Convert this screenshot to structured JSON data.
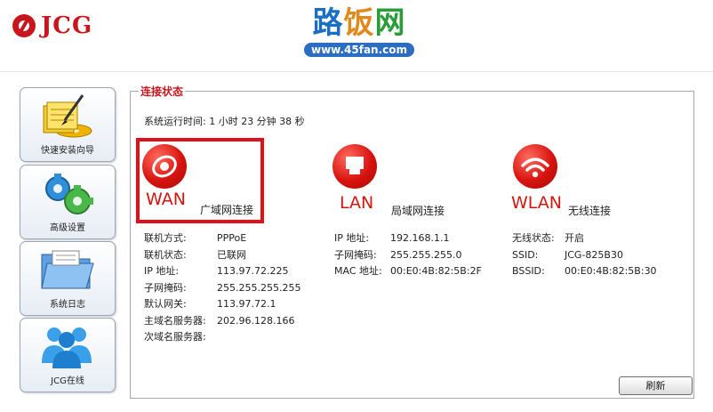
{
  "header": {
    "brand": "JCG",
    "site_name": [
      "路",
      "饭",
      "网"
    ],
    "site_url": "www.45fan.com"
  },
  "sidebar": {
    "items": [
      {
        "label": "快速安装向导",
        "icon": "setup-wizard-icon"
      },
      {
        "label": "高级设置",
        "icon": "gears-icon"
      },
      {
        "label": "系统日志",
        "icon": "folder-icon"
      },
      {
        "label": "JCG在线",
        "icon": "users-icon"
      }
    ]
  },
  "main": {
    "legend": "连接状态",
    "uptime": "系统运行时间: 1 小时 23 分钟 38 秒",
    "wan": {
      "title": "WAN",
      "caption": "广域网连接",
      "rows": [
        {
          "k": "联机方式:",
          "v": "PPPoE"
        },
        {
          "k": "联机状态:",
          "v": "已联网"
        },
        {
          "k": "IP 地址:",
          "v": "113.97.72.225"
        },
        {
          "k": "子网掩码:",
          "v": "255.255.255.255"
        },
        {
          "k": "默认网关:",
          "v": "113.97.72.1"
        },
        {
          "k": "主域名服务器:",
          "v": "202.96.128.166"
        },
        {
          "k": "次域名服务器:",
          "v": ""
        }
      ]
    },
    "lan": {
      "title": "LAN",
      "caption": "局域网连接",
      "rows": [
        {
          "k": "IP 地址:",
          "v": "192.168.1.1"
        },
        {
          "k": "子网掩码:",
          "v": "255.255.255.0"
        },
        {
          "k": "MAC 地址:",
          "v": "00:E0:4B:82:5B:2F"
        }
      ]
    },
    "wlan": {
      "title": "WLAN",
      "caption": "无线连接",
      "rows": [
        {
          "k": "无线状态:",
          "v": "开启"
        },
        {
          "k": "SSID:",
          "v": "JCG-825B30"
        },
        {
          "k": "BSSID:",
          "v": "00:E0:4B:82:5B:30"
        }
      ]
    },
    "refresh_label": "刷新"
  },
  "colors": {
    "accent_red": "#c8161d",
    "highlight_box": "#e0101a"
  }
}
